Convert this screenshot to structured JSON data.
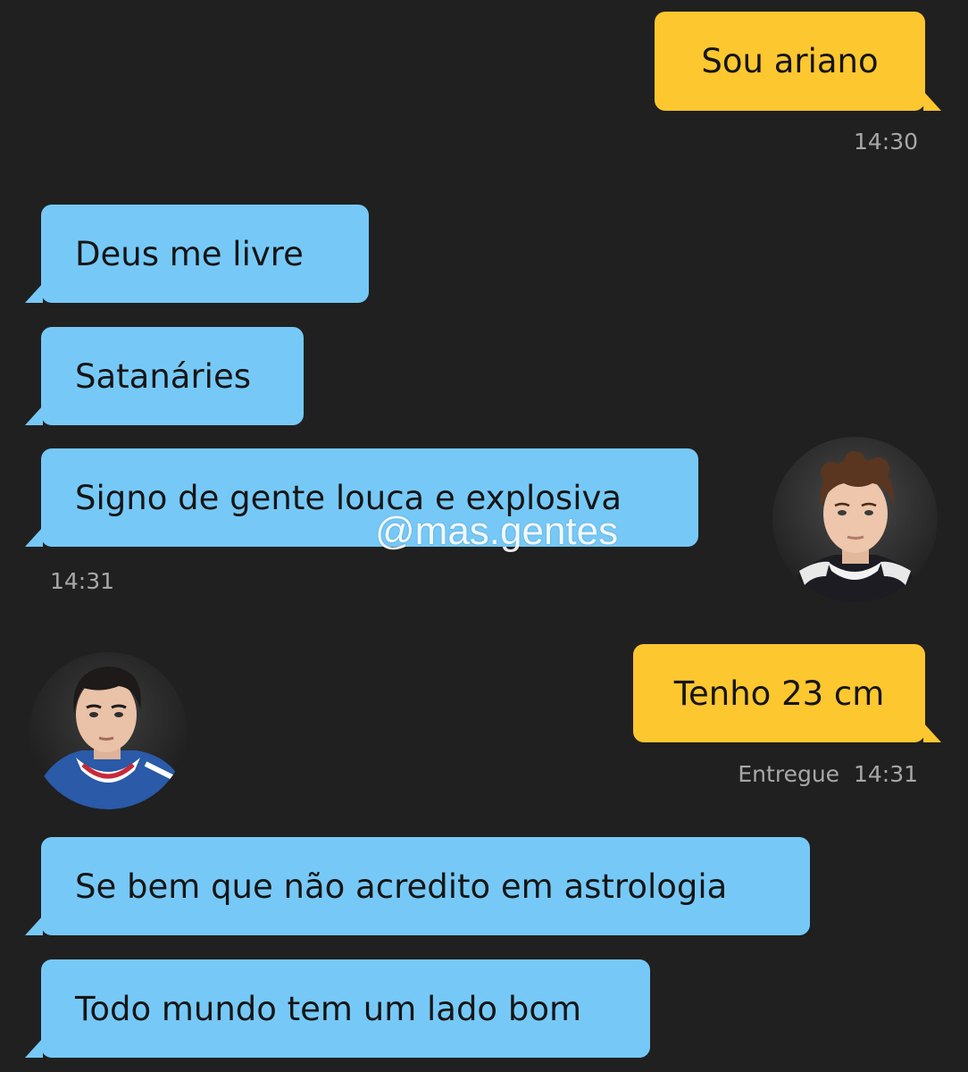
{
  "messages": [
    {
      "text": "Sou ariano",
      "direction": "outgoing"
    },
    {
      "text": "Deus me livre",
      "direction": "incoming"
    },
    {
      "text": "Satanáries",
      "direction": "incoming"
    },
    {
      "text": "Signo de gente louca e explosiva",
      "direction": "incoming"
    },
    {
      "text": "Tenho 23 cm",
      "direction": "outgoing"
    },
    {
      "text": "Se bem que não acredito em astrologia",
      "direction": "incoming"
    },
    {
      "text": "Todo mundo tem um lado bom",
      "direction": "incoming"
    }
  ],
  "timestamps": {
    "t1": "14:30",
    "t2": "14:31",
    "status": "Entregue",
    "t3": "14:31"
  },
  "watermark": "@mas.gentes",
  "colors": {
    "background": "#202020",
    "outgoing_bubble": "#fdc72f",
    "incoming_bubble": "#76c9f7",
    "timestamp": "#a8a8a8"
  }
}
